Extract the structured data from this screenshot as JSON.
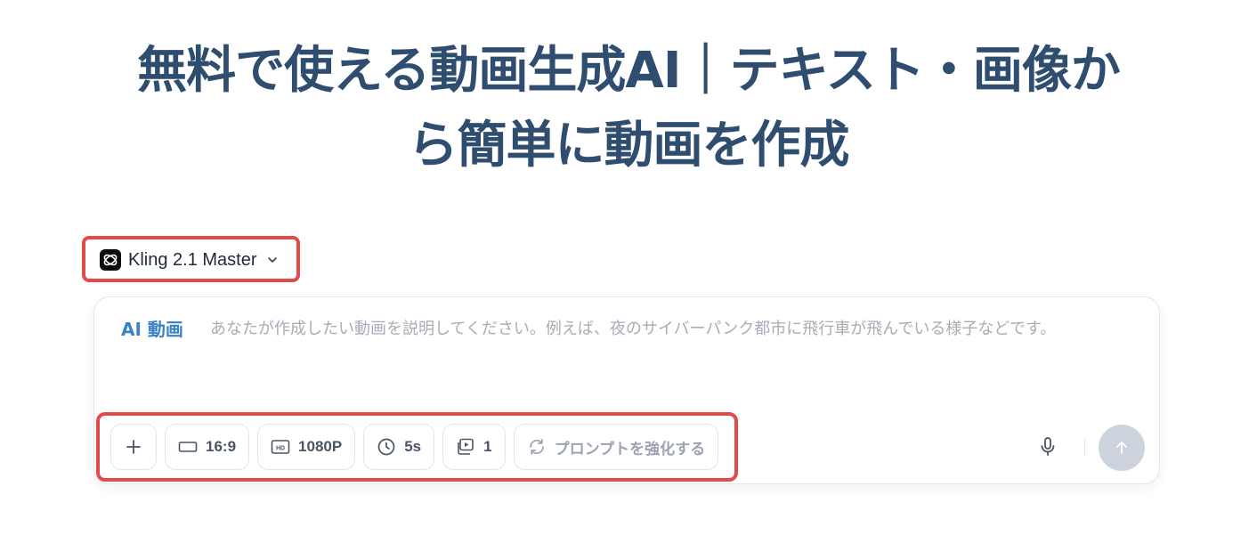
{
  "hero": {
    "title_line1": "無料で使える動画生成AI｜テキスト・画像か",
    "title_line2": "ら簡単に動画を作成"
  },
  "model_selector": {
    "name": "Kling 2.1 Master",
    "icon": "kling-logo-icon"
  },
  "prompt": {
    "label": "AI 動画",
    "placeholder": "あなたが作成したい動画を説明してください。例えば、夜のサイバーパンク都市に飛行車が飛んでいる様子などです。",
    "value": ""
  },
  "toolbar": {
    "add_icon": "plus-icon",
    "aspect_ratio": "16:9",
    "resolution": "1080P",
    "duration": "5s",
    "count": "1",
    "enhance_label": "プロンプトを強化する"
  },
  "actions": {
    "mic_icon": "microphone-icon",
    "send_icon": "arrow-up-icon"
  },
  "colors": {
    "title": "#2f4d6f",
    "accent": "#3b82c4",
    "highlight_border": "#e34b4b",
    "send_disabled": "#ccd3dc"
  }
}
